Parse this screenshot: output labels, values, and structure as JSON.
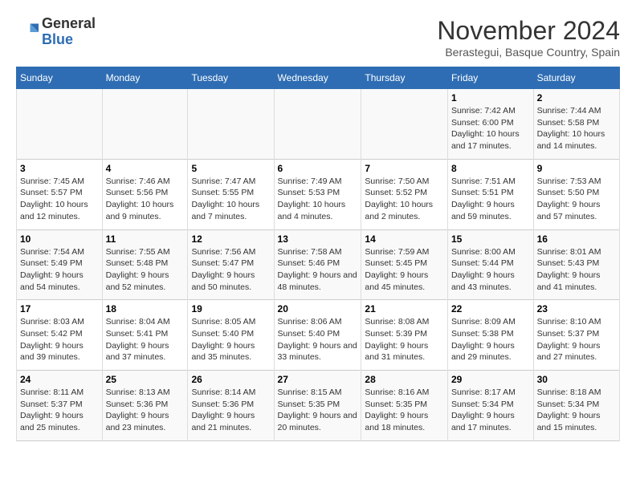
{
  "logo": {
    "line1": "General",
    "line2": "Blue"
  },
  "title": "November 2024",
  "location": "Berastegui, Basque Country, Spain",
  "days_of_week": [
    "Sunday",
    "Monday",
    "Tuesday",
    "Wednesday",
    "Thursday",
    "Friday",
    "Saturday"
  ],
  "weeks": [
    [
      {
        "day": "",
        "info": ""
      },
      {
        "day": "",
        "info": ""
      },
      {
        "day": "",
        "info": ""
      },
      {
        "day": "",
        "info": ""
      },
      {
        "day": "",
        "info": ""
      },
      {
        "day": "1",
        "info": "Sunrise: 7:42 AM\nSunset: 6:00 PM\nDaylight: 10 hours and 17 minutes."
      },
      {
        "day": "2",
        "info": "Sunrise: 7:44 AM\nSunset: 5:58 PM\nDaylight: 10 hours and 14 minutes."
      }
    ],
    [
      {
        "day": "3",
        "info": "Sunrise: 7:45 AM\nSunset: 5:57 PM\nDaylight: 10 hours and 12 minutes."
      },
      {
        "day": "4",
        "info": "Sunrise: 7:46 AM\nSunset: 5:56 PM\nDaylight: 10 hours and 9 minutes."
      },
      {
        "day": "5",
        "info": "Sunrise: 7:47 AM\nSunset: 5:55 PM\nDaylight: 10 hours and 7 minutes."
      },
      {
        "day": "6",
        "info": "Sunrise: 7:49 AM\nSunset: 5:53 PM\nDaylight: 10 hours and 4 minutes."
      },
      {
        "day": "7",
        "info": "Sunrise: 7:50 AM\nSunset: 5:52 PM\nDaylight: 10 hours and 2 minutes."
      },
      {
        "day": "8",
        "info": "Sunrise: 7:51 AM\nSunset: 5:51 PM\nDaylight: 9 hours and 59 minutes."
      },
      {
        "day": "9",
        "info": "Sunrise: 7:53 AM\nSunset: 5:50 PM\nDaylight: 9 hours and 57 minutes."
      }
    ],
    [
      {
        "day": "10",
        "info": "Sunrise: 7:54 AM\nSunset: 5:49 PM\nDaylight: 9 hours and 54 minutes."
      },
      {
        "day": "11",
        "info": "Sunrise: 7:55 AM\nSunset: 5:48 PM\nDaylight: 9 hours and 52 minutes."
      },
      {
        "day": "12",
        "info": "Sunrise: 7:56 AM\nSunset: 5:47 PM\nDaylight: 9 hours and 50 minutes."
      },
      {
        "day": "13",
        "info": "Sunrise: 7:58 AM\nSunset: 5:46 PM\nDaylight: 9 hours and 48 minutes."
      },
      {
        "day": "14",
        "info": "Sunrise: 7:59 AM\nSunset: 5:45 PM\nDaylight: 9 hours and 45 minutes."
      },
      {
        "day": "15",
        "info": "Sunrise: 8:00 AM\nSunset: 5:44 PM\nDaylight: 9 hours and 43 minutes."
      },
      {
        "day": "16",
        "info": "Sunrise: 8:01 AM\nSunset: 5:43 PM\nDaylight: 9 hours and 41 minutes."
      }
    ],
    [
      {
        "day": "17",
        "info": "Sunrise: 8:03 AM\nSunset: 5:42 PM\nDaylight: 9 hours and 39 minutes."
      },
      {
        "day": "18",
        "info": "Sunrise: 8:04 AM\nSunset: 5:41 PM\nDaylight: 9 hours and 37 minutes."
      },
      {
        "day": "19",
        "info": "Sunrise: 8:05 AM\nSunset: 5:40 PM\nDaylight: 9 hours and 35 minutes."
      },
      {
        "day": "20",
        "info": "Sunrise: 8:06 AM\nSunset: 5:40 PM\nDaylight: 9 hours and 33 minutes."
      },
      {
        "day": "21",
        "info": "Sunrise: 8:08 AM\nSunset: 5:39 PM\nDaylight: 9 hours and 31 minutes."
      },
      {
        "day": "22",
        "info": "Sunrise: 8:09 AM\nSunset: 5:38 PM\nDaylight: 9 hours and 29 minutes."
      },
      {
        "day": "23",
        "info": "Sunrise: 8:10 AM\nSunset: 5:37 PM\nDaylight: 9 hours and 27 minutes."
      }
    ],
    [
      {
        "day": "24",
        "info": "Sunrise: 8:11 AM\nSunset: 5:37 PM\nDaylight: 9 hours and 25 minutes."
      },
      {
        "day": "25",
        "info": "Sunrise: 8:13 AM\nSunset: 5:36 PM\nDaylight: 9 hours and 23 minutes."
      },
      {
        "day": "26",
        "info": "Sunrise: 8:14 AM\nSunset: 5:36 PM\nDaylight: 9 hours and 21 minutes."
      },
      {
        "day": "27",
        "info": "Sunrise: 8:15 AM\nSunset: 5:35 PM\nDaylight: 9 hours and 20 minutes."
      },
      {
        "day": "28",
        "info": "Sunrise: 8:16 AM\nSunset: 5:35 PM\nDaylight: 9 hours and 18 minutes."
      },
      {
        "day": "29",
        "info": "Sunrise: 8:17 AM\nSunset: 5:34 PM\nDaylight: 9 hours and 17 minutes."
      },
      {
        "day": "30",
        "info": "Sunrise: 8:18 AM\nSunset: 5:34 PM\nDaylight: 9 hours and 15 minutes."
      }
    ]
  ]
}
